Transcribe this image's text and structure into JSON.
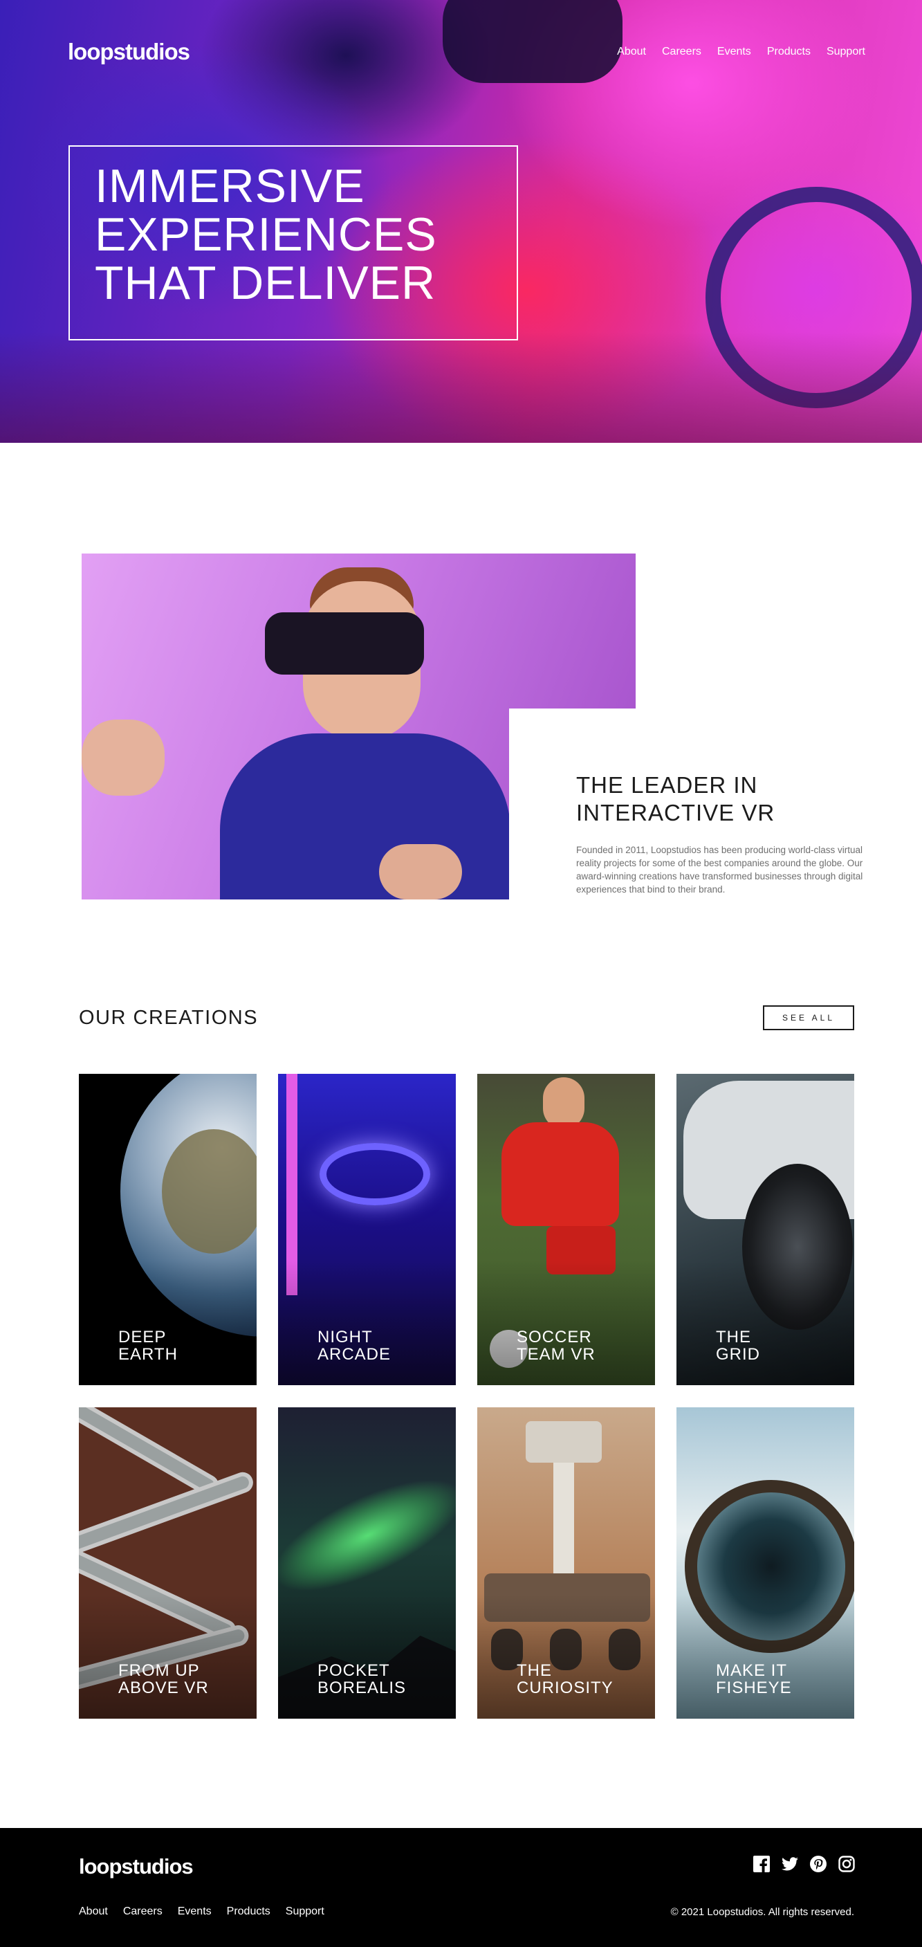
{
  "brand": {
    "logo_text": "loopstudios"
  },
  "nav": {
    "items": [
      "About",
      "Careers",
      "Events",
      "Products",
      "Support"
    ]
  },
  "hero": {
    "headline_lines": [
      "IMMERSIVE",
      "EXPERIENCES",
      "THAT DELIVER"
    ]
  },
  "leader": {
    "title_lines": [
      "THE LEADER IN",
      "INTERACTIVE VR"
    ],
    "body": "Founded in 2011, Loopstudios has been producing world-class virtual reality projects for some of the best companies around the globe. Our award-winning creations have transformed businesses through digital experiences that bind to their brand."
  },
  "creations": {
    "title": "OUR CREATIONS",
    "see_all_label": "SEE ALL",
    "items": [
      {
        "lines": [
          "DEEP",
          "EARTH"
        ]
      },
      {
        "lines": [
          "NIGHT",
          "ARCADE"
        ]
      },
      {
        "lines": [
          "SOCCER",
          "TEAM VR"
        ]
      },
      {
        "lines": [
          "THE",
          "GRID"
        ]
      },
      {
        "lines": [
          "FROM UP",
          "ABOVE VR"
        ]
      },
      {
        "lines": [
          "POCKET",
          "BOREALIS"
        ]
      },
      {
        "lines": [
          "THE",
          "CURIOSITY"
        ]
      },
      {
        "lines": [
          "MAKE IT",
          "FISHEYE"
        ]
      }
    ]
  },
  "footer": {
    "logo_text": "loopstudios",
    "nav_items": [
      "About",
      "Careers",
      "Events",
      "Products",
      "Support"
    ],
    "social_icons": [
      "facebook-icon",
      "twitter-icon",
      "pinterest-icon",
      "instagram-icon"
    ],
    "copyright": "© 2021 Loopstudios. All rights reserved."
  },
  "colors": {
    "footer_bg": "#000000",
    "text_dark": "#1b1b1b",
    "text_muted": "#6f6f6f",
    "white": "#ffffff"
  }
}
